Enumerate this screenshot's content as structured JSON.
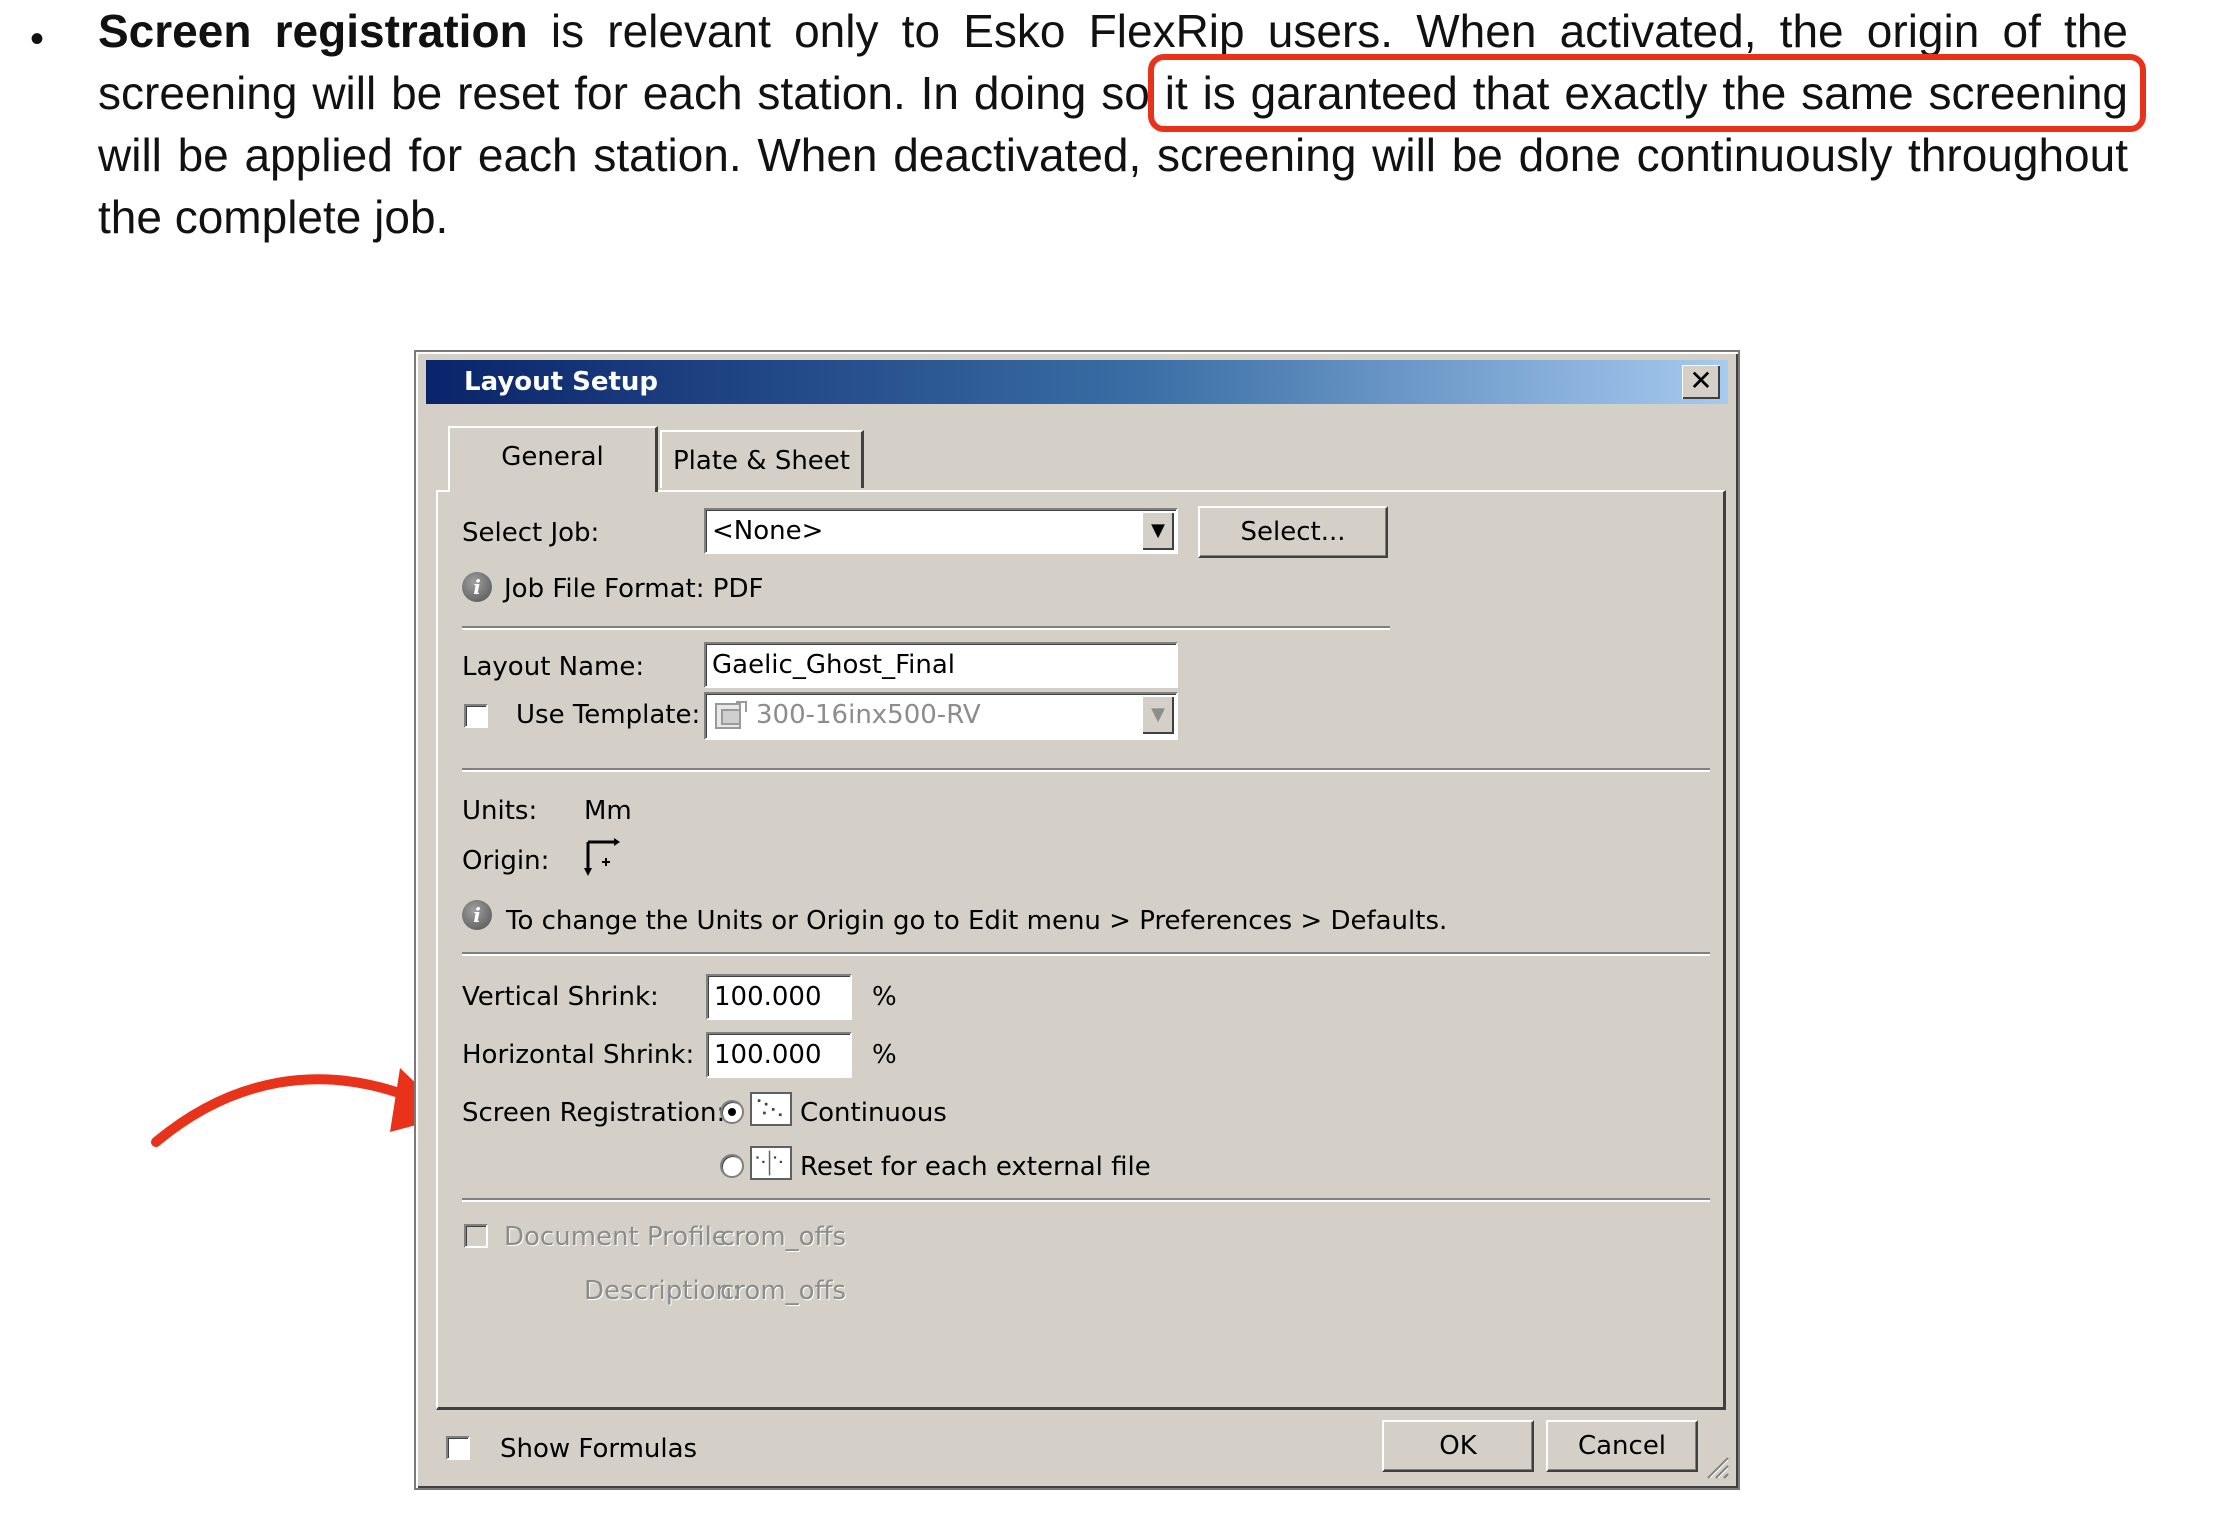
{
  "document": {
    "bullet": "•",
    "lead_bold": "Screen registration",
    "text_before_highlight": " is relevant only to Esko FlexRip users. When activated, the origin of the screening will be reset for each station. In doing so ",
    "highlighted_text": "it is garanteed that exactly the same screening",
    "text_after_highlight": " will be applied for each station. When deactivated, screening will be done continuously throughout the complete job.",
    "highlight_color": "#e8321a",
    "arrow_color": "#e8321a"
  },
  "dialog": {
    "title": "Layout Setup",
    "close_glyph": "✕",
    "tabs": [
      "General",
      "Plate & Sheet"
    ],
    "select_job": {
      "label": "Select Job:",
      "value": "<None>",
      "button": "Select..."
    },
    "job_file_format": "Job File Format: PDF",
    "layout_name": {
      "label": "Layout Name:",
      "value": "Gaelic_Ghost_Final"
    },
    "use_template": {
      "label": "Use Template:",
      "value": "300-16inx500-RV",
      "checked": false
    },
    "units": {
      "label": "Units:",
      "value": "Mm"
    },
    "origin": {
      "label": "Origin:",
      "icon": "origin-icon"
    },
    "units_note": "To change the Units or Origin go to Edit menu > Preferences > Defaults.",
    "vertical_shrink": {
      "label": "Vertical Shrink:",
      "value": "100.000",
      "unit": "%"
    },
    "horizontal_shrink": {
      "label": "Horizontal Shrink:",
      "value": "100.000",
      "unit": "%"
    },
    "screen_registration": {
      "label": "Screen Registration:",
      "options": [
        "Continuous",
        "Reset for each external file"
      ],
      "selected": "Continuous"
    },
    "document_profile": {
      "label": "Document Profile:",
      "value": "crom_offs",
      "enabled": false
    },
    "description": {
      "label": "Description:",
      "value": "crom_offs"
    },
    "show_formulas": {
      "label": "Show Formulas",
      "checked": false
    },
    "ok_button": "OK",
    "cancel_button": "Cancel",
    "dropdown_glyph": "▼"
  }
}
